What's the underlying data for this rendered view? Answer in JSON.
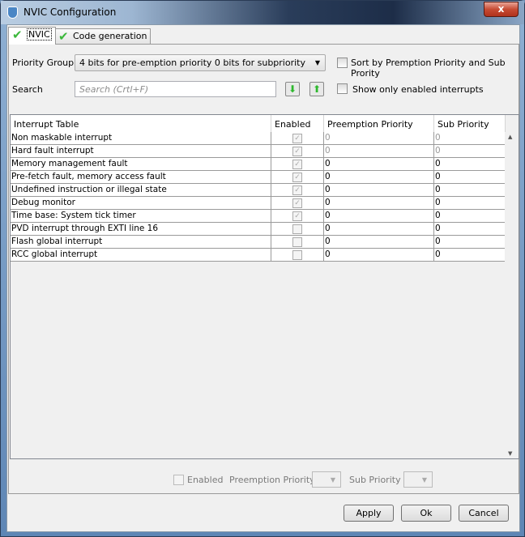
{
  "window": {
    "title": "NVIC Configuration",
    "close": "x"
  },
  "tabs": [
    {
      "label": "NVIC"
    },
    {
      "label": "Code generation"
    }
  ],
  "priority_group": {
    "label": "Priority Group",
    "value": "4 bits for pre-emption priority 0 bits for subpriority"
  },
  "sort_checkbox": {
    "label": "Sort by Premption Priority and Sub Prority",
    "checked": false
  },
  "search": {
    "label": "Search",
    "placeholder": "Search (Crtl+F)"
  },
  "show_enabled_checkbox": {
    "label": "Show only enabled interrupts",
    "checked": false
  },
  "table": {
    "headers": [
      "Interrupt Table",
      "Enabled",
      "Preemption Priority",
      "Sub Priority"
    ],
    "rows": [
      {
        "name": "Non maskable interrupt",
        "enabled": true,
        "preemption": "0",
        "sub": "0",
        "locked": true
      },
      {
        "name": "Hard fault interrupt",
        "enabled": true,
        "preemption": "0",
        "sub": "0",
        "locked": true
      },
      {
        "name": "Memory management fault",
        "enabled": true,
        "preemption": "0",
        "sub": "0",
        "locked": false
      },
      {
        "name": "Pre-fetch fault, memory access fault",
        "enabled": true,
        "preemption": "0",
        "sub": "0",
        "locked": false
      },
      {
        "name": "Undefined instruction or illegal state",
        "enabled": true,
        "preemption": "0",
        "sub": "0",
        "locked": false
      },
      {
        "name": "Debug monitor",
        "enabled": true,
        "preemption": "0",
        "sub": "0",
        "locked": false
      },
      {
        "name": "Time base: System tick timer",
        "enabled": true,
        "preemption": "0",
        "sub": "0",
        "locked": false
      },
      {
        "name": "PVD interrupt through EXTI line 16",
        "enabled": false,
        "preemption": "0",
        "sub": "0",
        "locked": false
      },
      {
        "name": "Flash global interrupt",
        "enabled": false,
        "preemption": "0",
        "sub": "0",
        "locked": false
      },
      {
        "name": "RCC global interrupt",
        "enabled": false,
        "preemption": "0",
        "sub": "0",
        "locked": false
      }
    ]
  },
  "bottom": {
    "enabled_label": "Enabled",
    "preemption_label": "Preemption Priority",
    "sub_label": "Sub Priority"
  },
  "buttons": {
    "apply": "Apply",
    "ok": "Ok",
    "cancel": "Cancel"
  }
}
